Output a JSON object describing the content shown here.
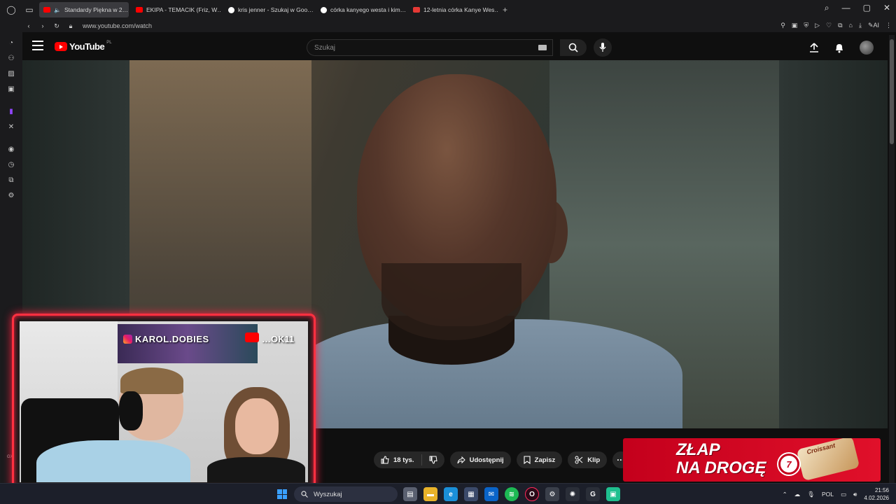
{
  "browser": {
    "tabs": [
      {
        "label": "Standardy Piękna w 2…",
        "favicon": "youtube",
        "active": true,
        "muted_icon": "speaker-icon"
      },
      {
        "label": "EKIPA - TEMACIK (Friz, W…",
        "favicon": "youtube",
        "active": false
      },
      {
        "label": "kris jenner - Szukaj w Goo…",
        "favicon": "google",
        "active": false
      },
      {
        "label": "córka kanyego westa i kim…",
        "favicon": "google",
        "active": false
      },
      {
        "label": "12-letnia córka Kanye Wes…",
        "favicon": "news",
        "active": false
      }
    ],
    "url": "www.youtube.com/watch",
    "ai_label": "AI"
  },
  "youtube": {
    "logo_text": "YouTube",
    "logo_region": "PL",
    "search_placeholder": "Szukaj"
  },
  "webcam": {
    "instagram_handle": "KAROL.DOBIES",
    "youtube_handle": "…OK11"
  },
  "actions": {
    "likes": "18 tys.",
    "share": "Udostępnij",
    "save": "Zapisz",
    "clip": "Klip"
  },
  "ad": {
    "line1": "ZŁAP",
    "line2": "NA DROGĘ",
    "badge": "7",
    "brand": "Croissant"
  },
  "sidebar_label": "GX",
  "taskbar": {
    "search_placeholder": "Wyszukaj",
    "language": "POL",
    "time": "21:56",
    "date": "4.02.2026"
  },
  "colors": {
    "youtube_red": "#ff0000",
    "overlay_border": "#ff3040",
    "ad_red": "#d0001e"
  }
}
